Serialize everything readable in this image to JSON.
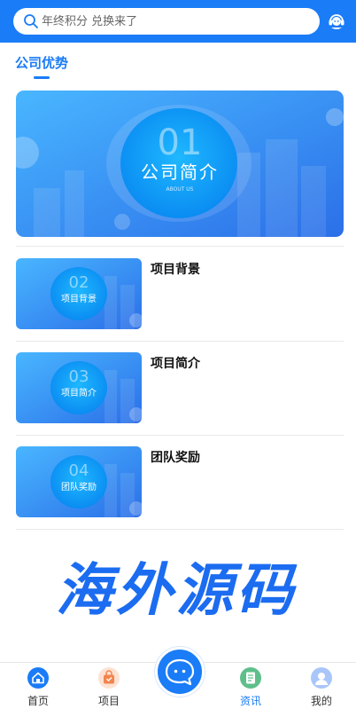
{
  "colors": {
    "primary": "#1a7cf7",
    "banner_light": "#3fb4ff",
    "banner_dark": "#2a72ea"
  },
  "search": {
    "placeholder": "年终积分 兑换来了",
    "icon": "search-icon"
  },
  "header": {
    "right_icon": "customer-service-icon"
  },
  "section": {
    "title": "公司优势"
  },
  "hero": {
    "number": "01",
    "title": "公司简介",
    "caption": "ABOUT US"
  },
  "items": [
    {
      "thumb_number": "02",
      "thumb_text": "项目背景",
      "title": "项目背景"
    },
    {
      "thumb_number": "03",
      "thumb_text": "项目简介",
      "title": "项目简介"
    },
    {
      "thumb_number": "04",
      "thumb_text": "团队奖励",
      "title": "团队奖励"
    }
  ],
  "watermark": "海外源码",
  "tabbar": {
    "home": {
      "label": "首页",
      "icon": "home-icon"
    },
    "project": {
      "label": "项目",
      "icon": "bag-icon"
    },
    "center": {
      "icon": "chat-bubble-icon"
    },
    "news": {
      "label": "资讯",
      "icon": "document-icon"
    },
    "mine": {
      "label": "我的",
      "icon": "user-icon"
    }
  }
}
